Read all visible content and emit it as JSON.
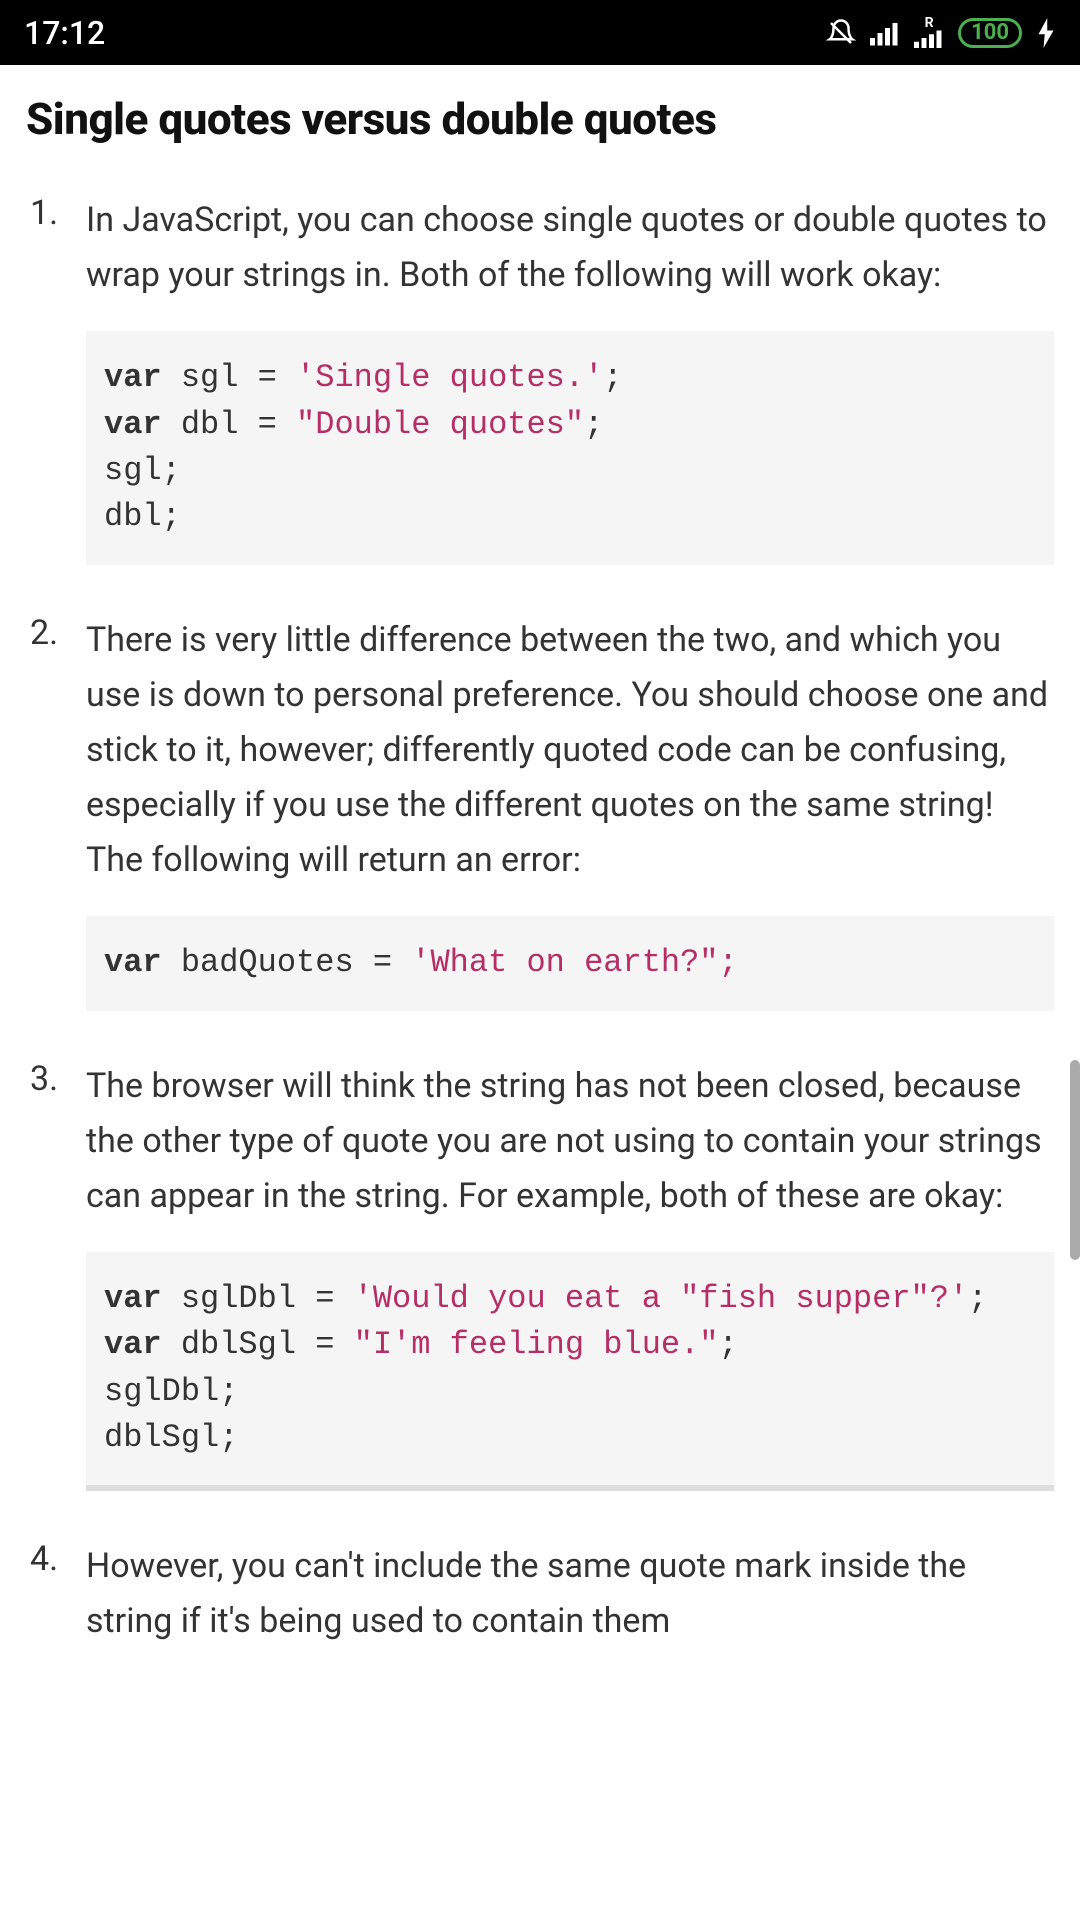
{
  "status_bar": {
    "time": "17:12",
    "battery": "100"
  },
  "heading": "Single quotes versus double quotes",
  "items": [
    {
      "text": "In JavaScript, you can choose single quotes or double quotes to wrap your strings in. Both of the following will work okay:",
      "code": {
        "lines": [
          {
            "kw": "var",
            "rest": " sgl = ",
            "str": "'Single quotes.'",
            "tail": ";"
          },
          {
            "kw": "var",
            "rest": " dbl = ",
            "str": "\"Double quotes\"",
            "tail": ";"
          },
          {
            "plain": "sgl;"
          },
          {
            "plain": "dbl;"
          }
        ]
      }
    },
    {
      "text": "There is very little difference between the two, and which you use is down to personal preference. You should choose one and stick to it, however; differently quoted code can be confusing, especially if you use the different quotes on the same string! The following will return an error:",
      "code": {
        "lines": [
          {
            "kw": "var",
            "rest": " badQuotes = ",
            "str": "'What on earth?\";",
            "tail": ""
          }
        ]
      }
    },
    {
      "text": "The browser will think the string has not been closed, because the other type of quote you are not using to contain your strings can appear in the string. For example, both of these are okay:",
      "code": {
        "lines": [
          {
            "kw": "var",
            "rest": " sglDbl = ",
            "str": "'Would you eat a \"fish supper\"?'",
            "tail": ";"
          },
          {
            "kw": "var",
            "rest": " dblSgl = ",
            "str": "\"I'm feeling blue.\"",
            "tail": ";"
          },
          {
            "plain": "sglDbl;"
          },
          {
            "plain": "dblSgl;"
          }
        ]
      }
    },
    {
      "text": "However, you can't include the same quote mark inside the string if it's being used to contain them"
    }
  ]
}
